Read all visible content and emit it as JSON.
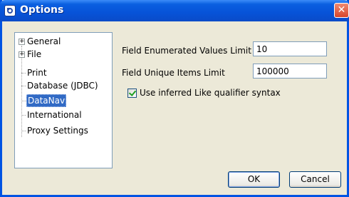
{
  "window": {
    "title": "Options",
    "close_glyph": "✕",
    "icon": "app-icon",
    "colors": {
      "titlebar": "#0753d8",
      "selection": "#316ac5",
      "dialog_bg": "#ece9d8"
    }
  },
  "tree": {
    "items": [
      {
        "label": "General",
        "expandable": true,
        "selected": false
      },
      {
        "label": "File",
        "expandable": true,
        "selected": false
      },
      {
        "label": "Print",
        "expandable": false,
        "selected": false
      },
      {
        "label": "Database (JDBC)",
        "expandable": false,
        "selected": false
      },
      {
        "label": "DataNav",
        "expandable": false,
        "selected": true
      },
      {
        "label": "International",
        "expandable": false,
        "selected": false
      },
      {
        "label": "Proxy Settings",
        "expandable": false,
        "selected": false
      }
    ],
    "expander_glyph": "+"
  },
  "settings": {
    "enum_limit_label": "Field Enumerated Values Limit",
    "enum_limit_value": "10",
    "unique_limit_label": "Field Unique Items Limit",
    "unique_limit_value": "100000",
    "inferred_like_label": "Use inferred Like qualifier syntax",
    "inferred_like_checked": true
  },
  "buttons": {
    "ok": "OK",
    "cancel": "Cancel"
  }
}
